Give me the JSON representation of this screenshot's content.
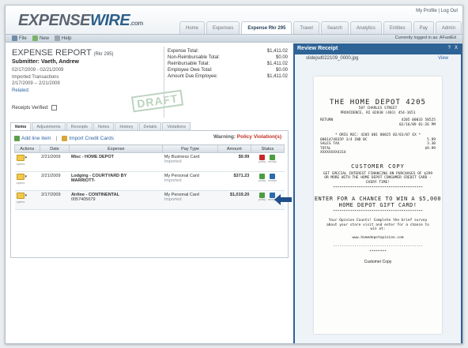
{
  "header": {
    "logo_main": "EXPENSE",
    "logo_wire": "WIRE",
    "logo_com": ".com",
    "user_links": "My Profile | Log Out",
    "tabs": [
      {
        "label": "Home",
        "active": false
      },
      {
        "label": "Expenses",
        "active": false
      },
      {
        "label": "Expense Rkr 295",
        "active": true
      },
      {
        "label": "Travel",
        "active": false
      },
      {
        "label": "Search",
        "active": false
      },
      {
        "label": "Analytics",
        "active": false
      },
      {
        "label": "Entities",
        "active": false
      },
      {
        "label": "Pay",
        "active": false
      },
      {
        "label": "Admin",
        "active": false
      }
    ]
  },
  "toolbar": {
    "file": "File",
    "new": "New",
    "help": "Help",
    "login_info": "Currently logged in as: AFastEd"
  },
  "report": {
    "title": "EXPENSE REPORT",
    "number": "(Rkr 295)",
    "submitter": "Submitter: Vaeth, Andrew",
    "dates": "02/17/2009 - 02/21/2009",
    "imported": "Imported Transactions",
    "imported_dates": "2/17/2009 -- 2/21/2009",
    "related": "Related:",
    "receipts_verified": "Receipts Verified:",
    "stamp": "DRAFT"
  },
  "totals": [
    {
      "label": "Expense Total:",
      "value": "$1,411.02"
    },
    {
      "label": "Non-Reimbursable Total:",
      "value": "$0.00"
    },
    {
      "label": "Reimbursable Total:",
      "value": "$1,411.02"
    },
    {
      "label": "Employee Owe Total:",
      "value": "$0.00"
    },
    {
      "label": "Amount Due Employee:",
      "value": "$1,411.02"
    }
  ],
  "subtabs": [
    {
      "label": "Items",
      "active": true
    },
    {
      "label": "Adjustments",
      "active": false
    },
    {
      "label": "Receipts",
      "active": false
    },
    {
      "label": "Notes",
      "active": false
    },
    {
      "label": "History",
      "active": false
    },
    {
      "label": "Details",
      "active": false
    },
    {
      "label": "Violations",
      "active": false
    }
  ],
  "actions": {
    "add_line": "Add line item",
    "import_cards": "Import Credit Cards",
    "warning_label": "Warning:",
    "warning_text": "Policy Violation(s)"
  },
  "table": {
    "columns": [
      "Actions",
      "Date",
      "Expense",
      "Pay Type",
      "Amount",
      "Status"
    ],
    "rows": [
      {
        "date": "2/21/2009",
        "expense": "Misc - HOME DEPOT",
        "expense_sub": "",
        "paytype": "My Business Card",
        "paysub": "Imported",
        "amount": "$9.99",
        "status": [
          "policy",
          "receipt"
        ],
        "status_colors": [
          "red",
          "green"
        ]
      },
      {
        "date": "2/21/2009",
        "expense": "Lodging - COURTYARD BY",
        "expense_sub": "MARRIOTT-",
        "paytype": "My Personal Card",
        "paysub": "Imported",
        "amount": "$371.23",
        "status": [
          "policy",
          "receipt"
        ],
        "status_colors": [
          "green",
          "blue"
        ]
      },
      {
        "date": "2/17/2009",
        "expense": "Airline - CONTINENTAL",
        "expense_sub": "0057405679",
        "paytype": "My Personal Card",
        "paysub": "Imported",
        "amount": "$1,019.20",
        "status": [
          "policy",
          "receipt"
        ],
        "status_colors": [
          "green",
          "blue"
        ]
      }
    ],
    "row_icon_label": "opens"
  },
  "review": {
    "title": "Review Receipt",
    "controls": [
      "?",
      "X"
    ],
    "filename": "slidejsd022109_0000.jpg",
    "view": "View"
  },
  "receipt": {
    "store": "THE HOME DEPOT 4205",
    "addr1": "587 CHARLES STREET",
    "addr2": "PROVIDENCE, RI 02838 (401) 454-1651",
    "return_label": "RETURN",
    "return_info": "4205 00033 58525",
    "return_date": "02/16/09  01:26 PM",
    "order_line": "* ORIG REC: 4205 001 80025 02/01/07 EX *",
    "item_line": "0801474835P 3/4 IND BC",
    "item_price": "5.99",
    "sales_tax_label": "SALES TAX",
    "sales_tax": "3.30",
    "total_label": "TOTAL",
    "total": "$9.99",
    "card": "XXXXXXXX4314",
    "customer_copy": "CUSTOMER COPY",
    "promo": "GET SPECIAL INTEREST FINANCING ON PURCHASES OF $299 OR MORE WITH THE HOME DEPOT CONSUMER CREDIT CARD - EVERY TIME!",
    "enter": "ENTER FOR A CHANCE TO WIN A $5,000 HOME DEPOT GIFT CARD!",
    "survey": "Your Opinion Counts! Complete the brief survey about your store visit and enter for a chance to win at:",
    "url": "www.homedepotopinion.com",
    "stars": "********",
    "footer": "Customer Copy"
  },
  "colors": {
    "accent": "#2e6396",
    "warning": "#c22c22"
  }
}
